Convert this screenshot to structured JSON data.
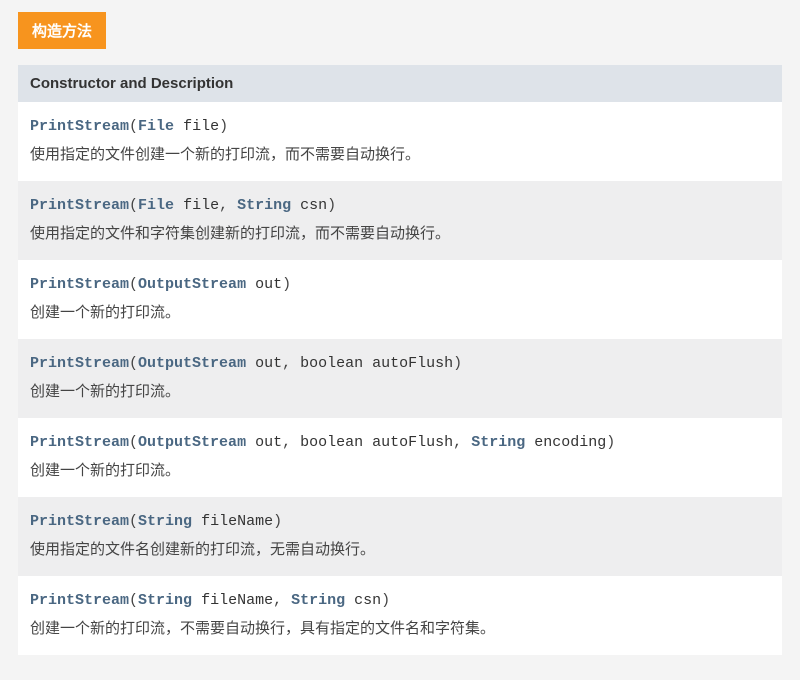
{
  "badge": "构造方法",
  "table_header": "Constructor and Description",
  "class_name": "PrintStream",
  "constructors": [
    {
      "params": [
        {
          "type_link": "File",
          "name": "file"
        }
      ],
      "description": "使用指定的文件创建一个新的打印流，而不需要自动换行。"
    },
    {
      "params": [
        {
          "type_link": "File",
          "name": "file"
        },
        {
          "type_link": "String",
          "name": "csn"
        }
      ],
      "description": "使用指定的文件和字符集创建新的打印流，而不需要自动换行。"
    },
    {
      "params": [
        {
          "type_link": "OutputStream",
          "name": "out"
        }
      ],
      "description": "创建一个新的打印流。"
    },
    {
      "params": [
        {
          "type_link": "OutputStream",
          "name": "out"
        },
        {
          "type_plain": "boolean",
          "name": "autoFlush"
        }
      ],
      "description": "创建一个新的打印流。"
    },
    {
      "params": [
        {
          "type_link": "OutputStream",
          "name": "out"
        },
        {
          "type_plain": "boolean",
          "name": "autoFlush"
        },
        {
          "type_link": "String",
          "name": "encoding"
        }
      ],
      "description": "创建一个新的打印流。"
    },
    {
      "params": [
        {
          "type_link": "String",
          "name": "fileName"
        }
      ],
      "description": "使用指定的文件名创建新的打印流，无需自动换行。"
    },
    {
      "params": [
        {
          "type_link": "String",
          "name": "fileName"
        },
        {
          "type_link": "String",
          "name": "csn"
        }
      ],
      "description": "创建一个新的打印流，不需要自动换行，具有指定的文件名和字符集。"
    }
  ]
}
